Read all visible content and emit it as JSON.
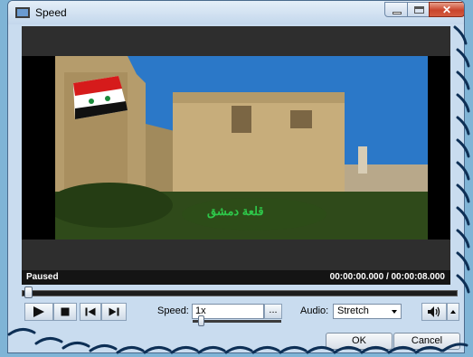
{
  "window": {
    "title": "Speed"
  },
  "video": {
    "status": "Paused",
    "time": "00:00:00.000 / 00:00:08.000",
    "caption": "قلعة دمشق"
  },
  "speed": {
    "label": "Speed:",
    "value": "1x",
    "more_label": "..."
  },
  "audio": {
    "label": "Audio:",
    "selected": "Stretch"
  },
  "dialog": {
    "ok_label": "OK",
    "cancel_label": "Cancel"
  },
  "colors": {
    "video_bg": "#000000",
    "panel": "#c9dcef",
    "accent": "#4a6a8c"
  },
  "icons": [
    "app-icon",
    "minimize-icon",
    "maximize-icon",
    "close-icon",
    "play-icon",
    "stop-icon",
    "previous-icon",
    "next-icon",
    "volume-icon",
    "arrow-up-icon"
  ]
}
